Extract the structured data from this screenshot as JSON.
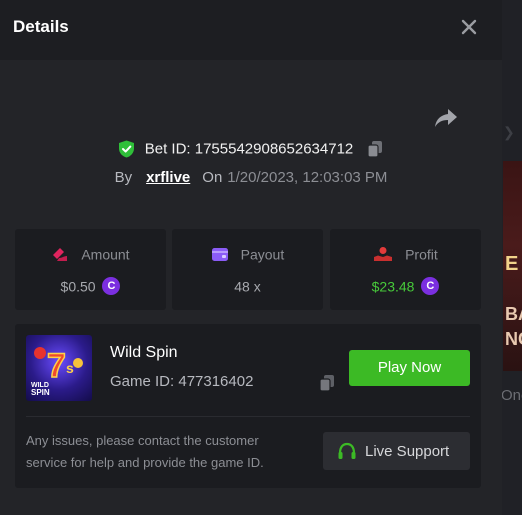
{
  "background": {
    "peek_texts": [
      "E",
      "BA",
      "NC"
    ],
    "peek_label": "One"
  },
  "modal": {
    "title": "Details",
    "icons": {
      "close": "close-icon",
      "share": "share-icon",
      "verified": "shield-check-icon",
      "copy": "copy-icon"
    },
    "bet": {
      "id_label": "Bet ID: 1755542908652634712",
      "by_label": "By",
      "user": "xrflive",
      "on_label": "On",
      "date": "1/20/2023, 12:03:03 PM"
    },
    "stats": [
      {
        "label": "Amount",
        "value": "$0.50",
        "icon": "amount-icon",
        "coin": true,
        "value_color": "#a7a9ae"
      },
      {
        "label": "Payout",
        "value": "48 x",
        "icon": "wallet-icon",
        "coin": false,
        "value_color": "#a7a9ae"
      },
      {
        "label": "Profit",
        "value": "$23.48",
        "icon": "profit-hand-icon",
        "coin": true,
        "value_color": "#47c93a"
      }
    ],
    "coin_symbol": "C",
    "game": {
      "name": "Wild Spin",
      "id_label": "Game ID: 477316402",
      "thumb_text": "WILD\nSPIN",
      "thumb_big": "7s",
      "play_label": "Play Now",
      "issue_text": "Any issues, please contact the customer service for help and provide the game ID.",
      "support_label": "Live Support"
    },
    "colors": {
      "accent_green": "#3cba25",
      "coin_purple": "#7b2fe0",
      "verified_green": "#2fbf39",
      "amount_pink": "#e0245e",
      "payout_purple": "#8b5cf6",
      "profit_red": "#e33b3b"
    }
  }
}
